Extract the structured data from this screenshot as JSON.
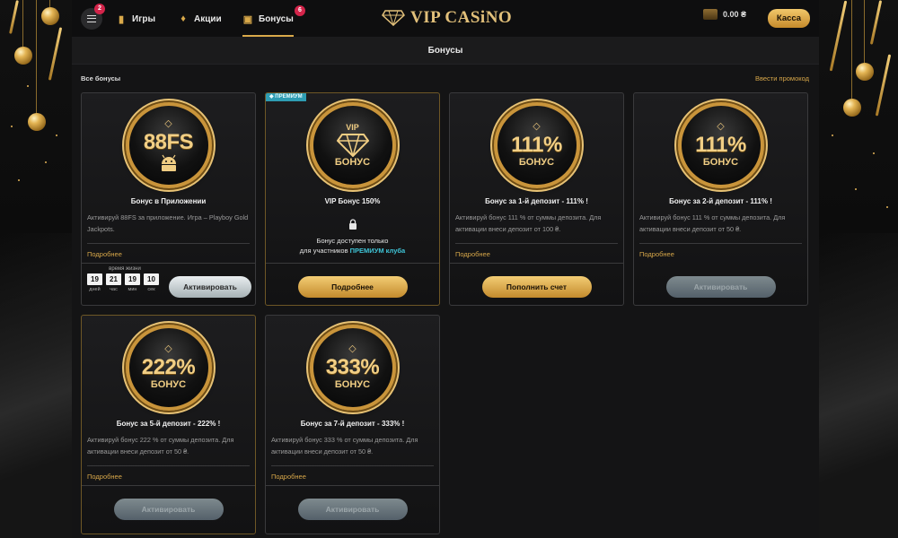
{
  "header": {
    "menu_badge": "2",
    "nav": [
      {
        "label": "Игры",
        "icon": "games-icon"
      },
      {
        "label": "Акции",
        "icon": "fire-icon"
      },
      {
        "label": "Бонусы",
        "icon": "gift-icon",
        "badge": "6",
        "active": true
      }
    ],
    "logo_text": "VIP CASiNO",
    "balance": "0.00 ₴",
    "cashier_label": "Касса"
  },
  "page": {
    "title": "Бонусы",
    "all_bonuses_label": "Все бонусы",
    "promo_link": "Ввести промокод"
  },
  "colors": {
    "accent_gold": "#d6a649",
    "premium": "#2e9db3",
    "badge": "#d3244a"
  },
  "cards": [
    {
      "medal_big": "88FS",
      "medal_icon": "android-icon",
      "title": "Бонус в Приложении",
      "desc": "Активируй 88FS за приложение. Игра – Playboy Gold Jackpots.",
      "more": "Подробнее",
      "timer_label": "время жизни",
      "timer": [
        {
          "value": "19",
          "unit": "дней"
        },
        {
          "value": "21",
          "unit": "час"
        },
        {
          "value": "19",
          "unit": "мин"
        },
        {
          "value": "10",
          "unit": "сек"
        }
      ],
      "button": "Активировать"
    },
    {
      "premium_tag": "ПРЕМИУМ",
      "medal_top": "VIP",
      "medal_small": "БОНУС",
      "title": "VIP Бонус 150%",
      "locked_line1": "Бонус доступен только",
      "locked_line2": "для участников ",
      "locked_premium": "ПРЕМИУМ клуба",
      "button": "Подробнее"
    },
    {
      "medal_big": "111%",
      "medal_small": "БОНУС",
      "title": "Бонус за 1-й депозит - 111% !",
      "desc": "Активируй бонус 111 % от суммы депозита. Для активации внеси депозит от 100 ₴.",
      "more": "Подробнее",
      "button": "Пополнить счет"
    },
    {
      "medal_big": "111%",
      "medal_small": "БОНУС",
      "title": "Бонус за 2-й депозит - 111% !",
      "desc": "Активируй бонус 111 % от суммы депозита. Для активации внеси депозит от 50 ₴.",
      "more": "Подробнее",
      "button": "Активировать"
    },
    {
      "medal_big": "222%",
      "medal_small": "БОНУС",
      "title": "Бонус за 5-й депозит - 222% !",
      "desc": "Активируй бонус 222 % от суммы депозита. Для активации внеси депозит от 50 ₴.",
      "more": "Подробнее",
      "button": "Активировать"
    },
    {
      "medal_big": "333%",
      "medal_small": "БОНУС",
      "title": "Бонус за 7-й депозит - 333% !",
      "desc": "Активируй бонус 333 % от суммы депозита. Для активации внеси депозит от 50 ₴.",
      "more": "Подробнее",
      "button": "Активировать"
    }
  ]
}
